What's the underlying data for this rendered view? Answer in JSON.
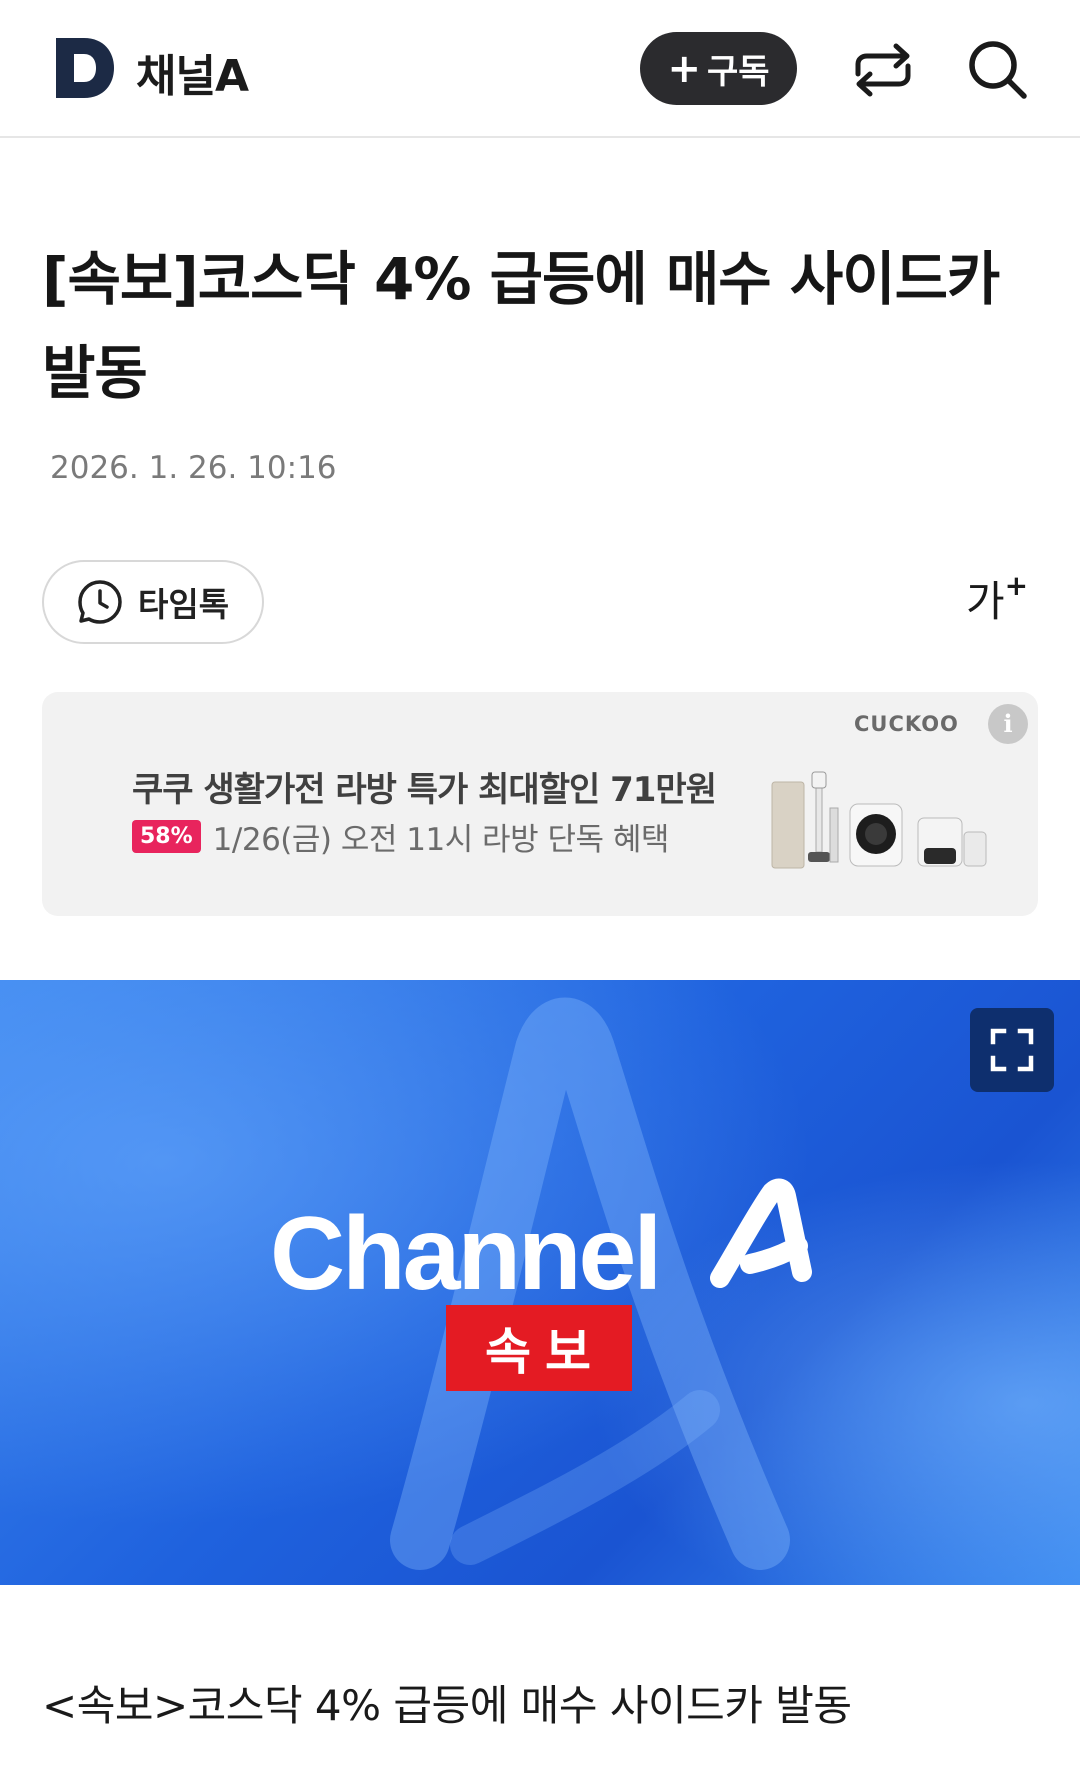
{
  "header": {
    "logo_letter": "D",
    "brand": "채널A",
    "subscribe_label": "구독",
    "share_icon": "share-arrows-icon",
    "search_icon": "search-icon"
  },
  "article": {
    "title": "[속보]코스닥 4% 급등에 매수 사이드카 발동",
    "date": "2026. 1. 26. 10:16",
    "timetalk_label": "타임톡",
    "fontsize_label": "가",
    "fontsize_plus": "+",
    "body_first_line": "<속보>코스닥 4% 급등에 매수 사이드카 발동"
  },
  "ad": {
    "brand": "CUCKOO",
    "info": "i",
    "headline": "쿠쿠 생활가전 라방 특가 최대할인 71만원",
    "badge": "58%",
    "subtext": "1/26(금) 오전 11시 라방 단독 혜택"
  },
  "hero": {
    "channel_text": "Channel",
    "badge": "속보"
  },
  "colors": {
    "accent_dark": "#2b2b2e",
    "logo_navy": "#1c2a45",
    "badge_pink": "#e8245d",
    "breaking_red": "#e41b23",
    "hero_blue": "#1f62de"
  }
}
